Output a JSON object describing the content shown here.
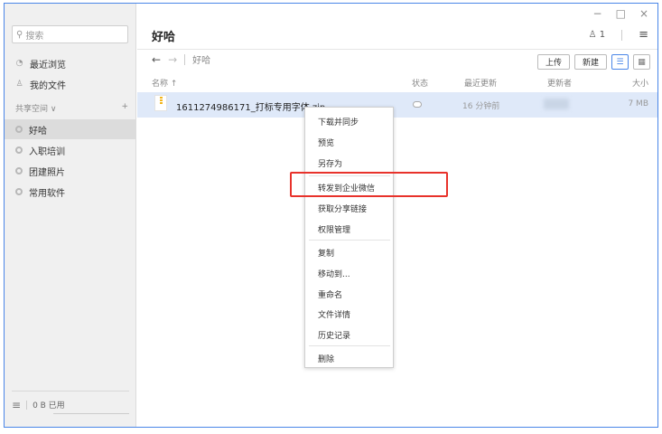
{
  "window": {
    "controls": [
      "−",
      "□",
      "×"
    ]
  },
  "sidebar": {
    "search_placeholder": "搜索",
    "recent": "最近浏览",
    "my_files": "我的文件",
    "shared_space": "共享空间",
    "shared_space_caret": "∨",
    "add": "+",
    "spaces": [
      "好哈",
      "入职培训",
      "团建照片",
      "常用软件"
    ],
    "storage": "0 B 已用"
  },
  "main": {
    "title": "好哈",
    "member_count": "1",
    "menu_icon": "≡",
    "breadcrumb": "好哈",
    "toolbar": {
      "upload": "上传",
      "new": "新建"
    },
    "columns": {
      "name": "名称 ↑",
      "status": "状态",
      "updated": "最近更新",
      "updater": "更新者",
      "size": "大小"
    },
    "file": {
      "name": "1611274986171_打标专用字体.zip",
      "time": "16 分钟前",
      "size": "7 MB"
    }
  },
  "context_menu": {
    "items": [
      "下载并同步",
      "预览",
      "另存为",
      "转发到企业微信",
      "获取分享链接",
      "权限管理",
      "复制",
      "移动到...",
      "重命名",
      "文件详情",
      "历史记录",
      "删除"
    ]
  },
  "colors": {
    "accent": "#4a86e8",
    "selection": "#dfe9f9",
    "highlight": "#e8322b"
  }
}
